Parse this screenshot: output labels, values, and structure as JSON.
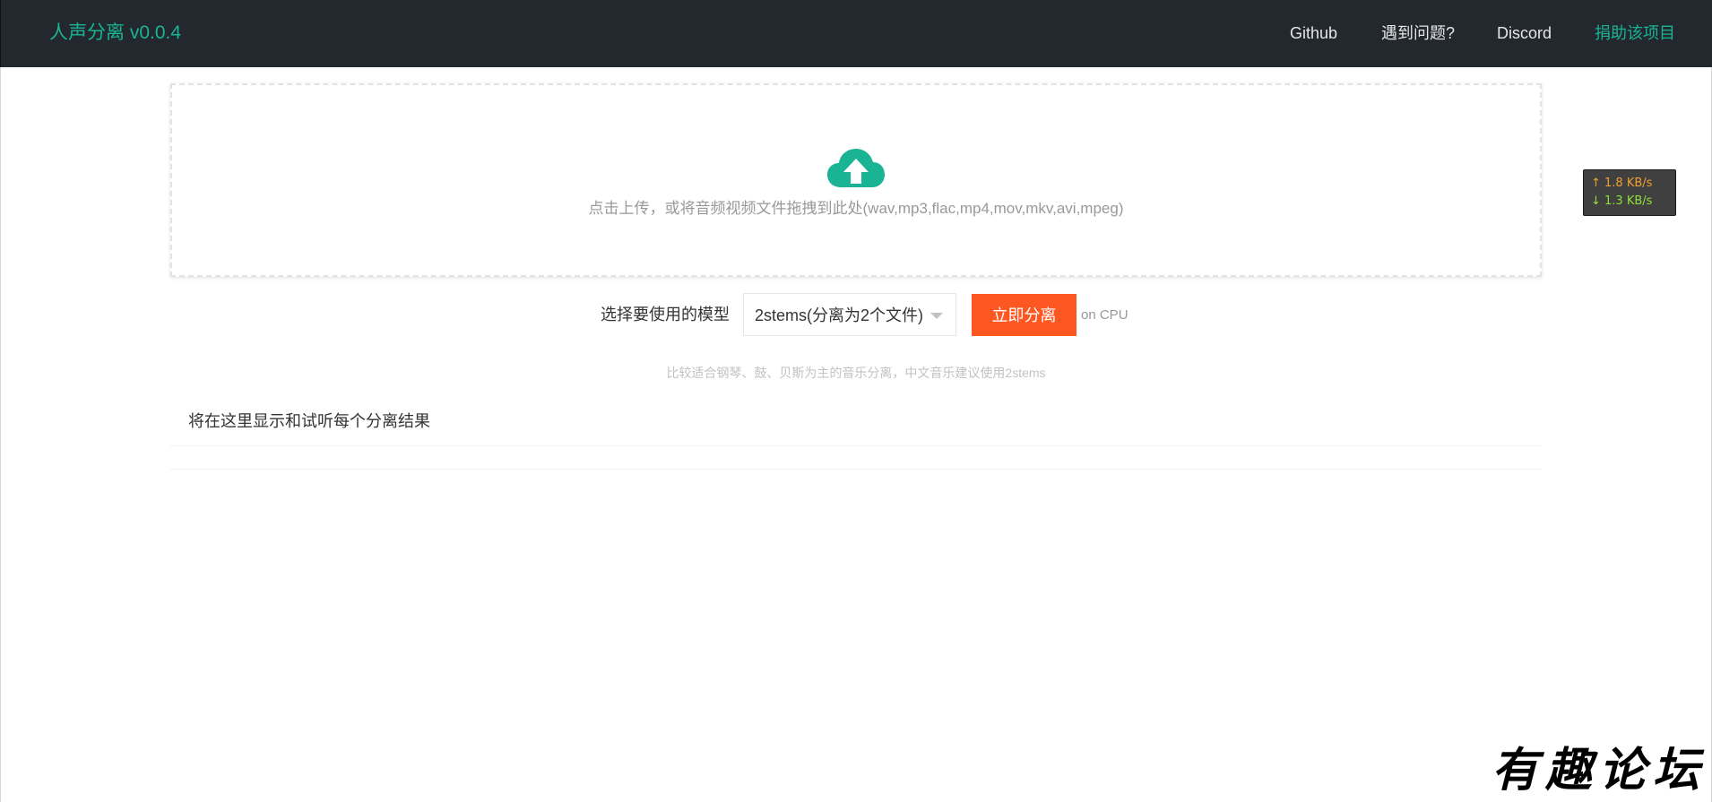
{
  "header": {
    "brand": "人声分离 v0.0.4",
    "links": {
      "github": "Github",
      "issues": "遇到问题?",
      "discord": "Discord",
      "donate": "捐助该项目"
    }
  },
  "upload": {
    "icon": "cloud-upload-icon",
    "hint": "点击上传，或将音频视频文件拖拽到此处(wav,mp3,flac,mp4,mov,mkv,avi,mpeg)"
  },
  "model": {
    "label": "选择要使用的模型",
    "selected": "2stems(分离为2个文件)",
    "action": "立即分离",
    "device": "on CPU",
    "tip": "比较适合钢琴、鼓、贝斯为主的音乐分离，中文音乐建议使用2stems"
  },
  "results": {
    "title": "将在这里显示和试听每个分离结果"
  },
  "network": {
    "up": "↑ 1.8 KB/s",
    "down": "↓ 1.3 KB/s"
  },
  "watermark": "有趣论坛",
  "colors": {
    "navbar": "#23282e",
    "accent": "#1ab394",
    "button": "#ff5722"
  }
}
